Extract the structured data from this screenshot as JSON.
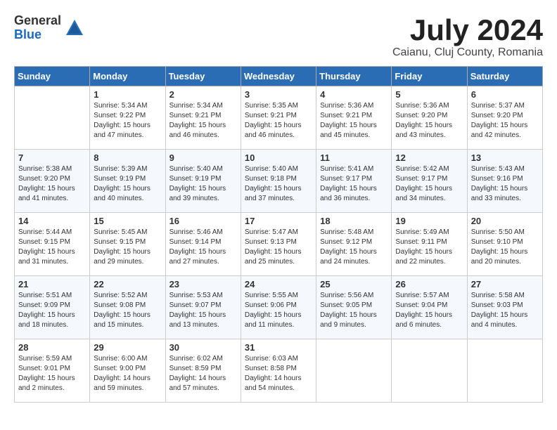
{
  "header": {
    "logo_general": "General",
    "logo_blue": "Blue",
    "month_title": "July 2024",
    "location": "Caianu, Cluj County, Romania"
  },
  "weekdays": [
    "Sunday",
    "Monday",
    "Tuesday",
    "Wednesday",
    "Thursday",
    "Friday",
    "Saturday"
  ],
  "weeks": [
    [
      {
        "day": "",
        "content": ""
      },
      {
        "day": "1",
        "content": "Sunrise: 5:34 AM\nSunset: 9:22 PM\nDaylight: 15 hours\nand 47 minutes."
      },
      {
        "day": "2",
        "content": "Sunrise: 5:34 AM\nSunset: 9:21 PM\nDaylight: 15 hours\nand 46 minutes."
      },
      {
        "day": "3",
        "content": "Sunrise: 5:35 AM\nSunset: 9:21 PM\nDaylight: 15 hours\nand 46 minutes."
      },
      {
        "day": "4",
        "content": "Sunrise: 5:36 AM\nSunset: 9:21 PM\nDaylight: 15 hours\nand 45 minutes."
      },
      {
        "day": "5",
        "content": "Sunrise: 5:36 AM\nSunset: 9:20 PM\nDaylight: 15 hours\nand 43 minutes."
      },
      {
        "day": "6",
        "content": "Sunrise: 5:37 AM\nSunset: 9:20 PM\nDaylight: 15 hours\nand 42 minutes."
      }
    ],
    [
      {
        "day": "7",
        "content": "Sunrise: 5:38 AM\nSunset: 9:20 PM\nDaylight: 15 hours\nand 41 minutes."
      },
      {
        "day": "8",
        "content": "Sunrise: 5:39 AM\nSunset: 9:19 PM\nDaylight: 15 hours\nand 40 minutes."
      },
      {
        "day": "9",
        "content": "Sunrise: 5:40 AM\nSunset: 9:19 PM\nDaylight: 15 hours\nand 39 minutes."
      },
      {
        "day": "10",
        "content": "Sunrise: 5:40 AM\nSunset: 9:18 PM\nDaylight: 15 hours\nand 37 minutes."
      },
      {
        "day": "11",
        "content": "Sunrise: 5:41 AM\nSunset: 9:17 PM\nDaylight: 15 hours\nand 36 minutes."
      },
      {
        "day": "12",
        "content": "Sunrise: 5:42 AM\nSunset: 9:17 PM\nDaylight: 15 hours\nand 34 minutes."
      },
      {
        "day": "13",
        "content": "Sunrise: 5:43 AM\nSunset: 9:16 PM\nDaylight: 15 hours\nand 33 minutes."
      }
    ],
    [
      {
        "day": "14",
        "content": "Sunrise: 5:44 AM\nSunset: 9:15 PM\nDaylight: 15 hours\nand 31 minutes."
      },
      {
        "day": "15",
        "content": "Sunrise: 5:45 AM\nSunset: 9:15 PM\nDaylight: 15 hours\nand 29 minutes."
      },
      {
        "day": "16",
        "content": "Sunrise: 5:46 AM\nSunset: 9:14 PM\nDaylight: 15 hours\nand 27 minutes."
      },
      {
        "day": "17",
        "content": "Sunrise: 5:47 AM\nSunset: 9:13 PM\nDaylight: 15 hours\nand 25 minutes."
      },
      {
        "day": "18",
        "content": "Sunrise: 5:48 AM\nSunset: 9:12 PM\nDaylight: 15 hours\nand 24 minutes."
      },
      {
        "day": "19",
        "content": "Sunrise: 5:49 AM\nSunset: 9:11 PM\nDaylight: 15 hours\nand 22 minutes."
      },
      {
        "day": "20",
        "content": "Sunrise: 5:50 AM\nSunset: 9:10 PM\nDaylight: 15 hours\nand 20 minutes."
      }
    ],
    [
      {
        "day": "21",
        "content": "Sunrise: 5:51 AM\nSunset: 9:09 PM\nDaylight: 15 hours\nand 18 minutes."
      },
      {
        "day": "22",
        "content": "Sunrise: 5:52 AM\nSunset: 9:08 PM\nDaylight: 15 hours\nand 15 minutes."
      },
      {
        "day": "23",
        "content": "Sunrise: 5:53 AM\nSunset: 9:07 PM\nDaylight: 15 hours\nand 13 minutes."
      },
      {
        "day": "24",
        "content": "Sunrise: 5:55 AM\nSunset: 9:06 PM\nDaylight: 15 hours\nand 11 minutes."
      },
      {
        "day": "25",
        "content": "Sunrise: 5:56 AM\nSunset: 9:05 PM\nDaylight: 15 hours\nand 9 minutes."
      },
      {
        "day": "26",
        "content": "Sunrise: 5:57 AM\nSunset: 9:04 PM\nDaylight: 15 hours\nand 6 minutes."
      },
      {
        "day": "27",
        "content": "Sunrise: 5:58 AM\nSunset: 9:03 PM\nDaylight: 15 hours\nand 4 minutes."
      }
    ],
    [
      {
        "day": "28",
        "content": "Sunrise: 5:59 AM\nSunset: 9:01 PM\nDaylight: 15 hours\nand 2 minutes."
      },
      {
        "day": "29",
        "content": "Sunrise: 6:00 AM\nSunset: 9:00 PM\nDaylight: 14 hours\nand 59 minutes."
      },
      {
        "day": "30",
        "content": "Sunrise: 6:02 AM\nSunset: 8:59 PM\nDaylight: 14 hours\nand 57 minutes."
      },
      {
        "day": "31",
        "content": "Sunrise: 6:03 AM\nSunset: 8:58 PM\nDaylight: 14 hours\nand 54 minutes."
      },
      {
        "day": "",
        "content": ""
      },
      {
        "day": "",
        "content": ""
      },
      {
        "day": "",
        "content": ""
      }
    ]
  ]
}
